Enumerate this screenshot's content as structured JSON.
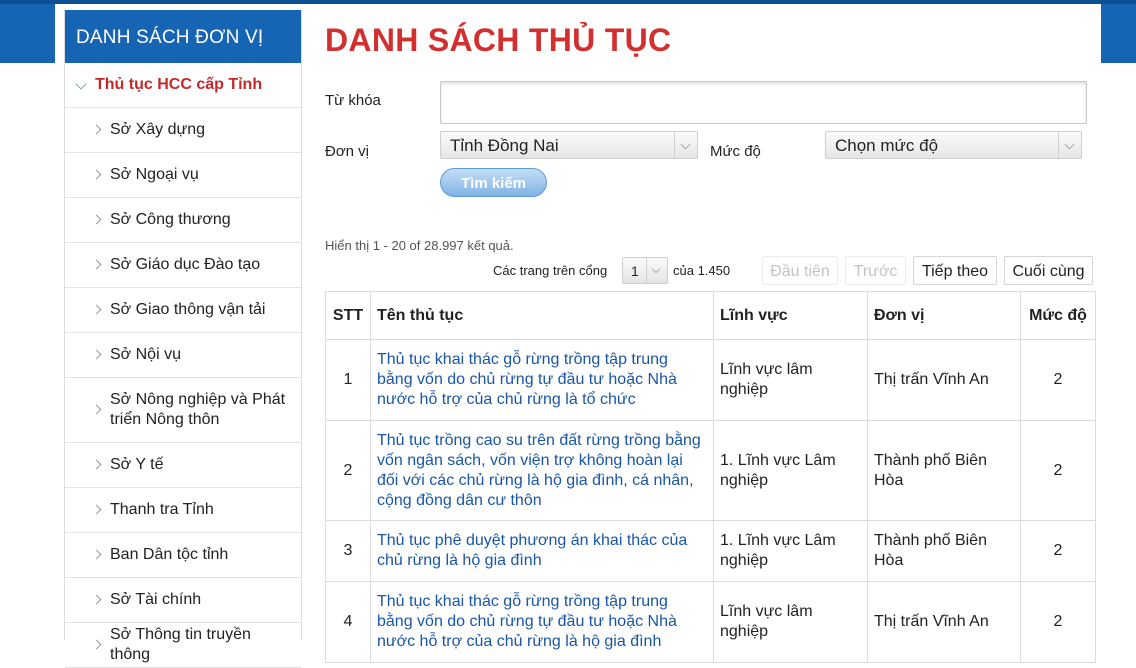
{
  "sidebar": {
    "header": "DANH SÁCH ĐƠN VỊ",
    "top_item": "Thủ tục HCC cấp Tỉnh",
    "items": [
      {
        "label": "Sở Xây dựng"
      },
      {
        "label": "Sở Ngoại vụ"
      },
      {
        "label": "Sở Công thương"
      },
      {
        "label": "Sở Giáo dục Đào tạo"
      },
      {
        "label": "Sở Giao thông vận tải"
      },
      {
        "label": "Sở Nội vụ"
      },
      {
        "label": "Sở Nông nghiệp và Phát triển Nông thôn"
      },
      {
        "label": "Sở Y tế"
      },
      {
        "label": "Thanh tra Tỉnh"
      },
      {
        "label": "Ban Dân tộc tỉnh"
      },
      {
        "label": "Sở Tài chính"
      },
      {
        "label": "Sở Thông tin truyền thông"
      }
    ]
  },
  "main": {
    "title": "DANH SÁCH THỦ TỤC",
    "form": {
      "keyword_label": "Từ khóa",
      "keyword_value": "",
      "unit_label": "Đơn vị",
      "unit_value": "Tỉnh Đồng Nai",
      "level_label": "Mức độ",
      "level_value": "Chọn mức độ",
      "search_button": "Tìm kiếm"
    },
    "results": {
      "summary": "Hiển thị 1 - 20 of 28.997 kết quả.",
      "pages_label": "Các trang trên cổng",
      "current_page": "1",
      "of_total": "của 1.450",
      "first": "Đầu tiên",
      "prev": "Trước",
      "next": "Tiếp theo",
      "last": "Cuối cùng"
    },
    "table": {
      "headers": {
        "stt": "STT",
        "name": "Tên thủ tục",
        "field": "Lĩnh vực",
        "unit": "Đơn vị",
        "level": "Mức độ"
      },
      "rows": [
        {
          "stt": "1",
          "name": "Thủ tục khai thác gỗ rừng trồng tập trung bằng vốn do chủ rừng tự đầu tư hoặc Nhà nước hỗ trợ của chủ rừng là tổ chức",
          "field": "Lĩnh vực lâm nghiệp",
          "unit": "Thị trấn Vĩnh An",
          "level": "2"
        },
        {
          "stt": "2",
          "name": "Thủ tục trồng cao su trên đất rừng trồng bằng vốn ngân sách, vốn viện trợ không hoàn lại đối với các chủ rừng là hộ gia đình, cá nhân, cộng đồng dân cư thôn",
          "field": "1. Lĩnh vực Lâm nghiệp",
          "unit": "Thành phố Biên Hòa",
          "level": "2"
        },
        {
          "stt": "3",
          "name": "Thủ tục phê duyệt phương án khai thác của chủ rừng là hộ gia đình",
          "field": "1. Lĩnh vực Lâm nghiệp",
          "unit": "Thành phố Biên Hòa",
          "level": "2"
        },
        {
          "stt": "4",
          "name": "Thủ tục khai thác gỗ rừng trồng tập trung bằng vốn do chủ rừng tự đầu tư hoặc Nhà nước hỗ trợ của chủ rừng là hộ gia đình",
          "field": "Lĩnh vực lâm nghiệp",
          "unit": "Thị trấn Vĩnh An",
          "level": "2"
        }
      ]
    }
  },
  "colors": {
    "brand_blue": "#1565b4",
    "title_red": "#d32f2f",
    "link_blue": "#1a56a6"
  }
}
